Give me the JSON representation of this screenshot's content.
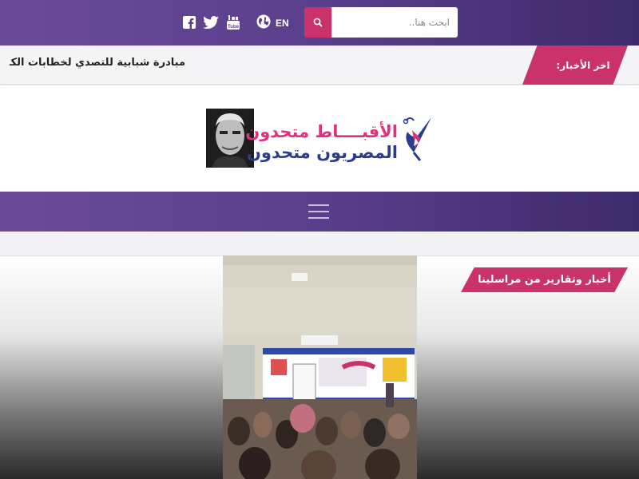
{
  "header": {
    "search": {
      "placeholder": "ابحث هنا..",
      "value": ""
    },
    "language_label": "EN",
    "social": [
      "facebook-icon",
      "twitter-icon",
      "youtube-icon"
    ]
  },
  "ticker": {
    "label": "اخر الأخبار:",
    "headline": "مبادرة شبابية للتصدي لخطابات الكراهية"
  },
  "logo": {
    "line1": "الأقبــــاط متحدون",
    "line2": "المصريون متحدون"
  },
  "article": {
    "category": "أخبار وتقارير من مراسلينا"
  },
  "colors": {
    "accent": "#c9326a",
    "header_purple": "#5a3f8c",
    "logo_pink": "#e0317c",
    "logo_blue": "#2a3c8e"
  }
}
